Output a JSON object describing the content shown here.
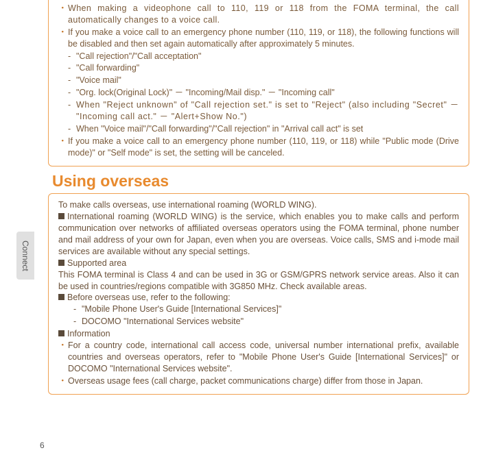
{
  "sidebar": {
    "label": "Connect"
  },
  "box1": {
    "items": [
      {
        "text": "When making a videophone call to 110, 119 or 118 from the FOMA terminal, the call automatically changes to a voice call."
      },
      {
        "text": "If you make a voice call to an emergency phone number (110, 119, or 118), the following functions will be disabled and then set again automatically after approximately 5 minutes.",
        "subs": [
          "\"Call rejection\"/\"Call acceptation\"",
          "\"Call forwarding\"",
          "\"Voice mail\"",
          "\"Org. lock(Original Lock)\" － \"Incoming/Mail disp.\" － \"Incoming call\"",
          "When \"Reject unknown\" of \"Call rejection set.\" is set to \"Reject\" (also including \"Secret\" － \"Incoming call act.\" － \"Alert+Show No.\")",
          "When \"Voice mail\"/\"Call forwarding\"/\"Call rejection\" in \"Arrival call act\" is set"
        ]
      },
      {
        "text": "If you make a voice call to an emergency phone number (110, 119, or 118) while \"Public mode (Drive mode)\" or \"Self mode\" is set, the setting will be canceled."
      }
    ]
  },
  "heading": "Using overseas",
  "box2": {
    "intro": "To make calls overseas, use international roaming (WORLD WING).",
    "worldwing_label": "International roaming (WORLD WING) is the service, which enables you to make calls and perform communication over networks of affiliated overseas operators using the FOMA terminal, phone number and mail address of your own for Japan, even when you are overseas. Voice calls, SMS and i-mode mail services are available without any special settings.",
    "supported_label": "Supported area",
    "supported_text": "This FOMA terminal is Class 4 and can be used in 3G or GSM/GPRS network service areas. Also it can be used in countries/regions compatible with 3G850 MHz. Check available areas.",
    "before_label": "Before overseas use, refer to the following:",
    "before_subs": [
      "\"Mobile Phone User's Guide [International Services]\"",
      "DOCOMO \"International Services website\""
    ],
    "info_label": "Information",
    "info_items": [
      "For a country code, international call access code, universal number international prefix, available countries and overseas operators, refer to \"Mobile Phone User's Guide [International Services]\" or DOCOMO \"International Services website\".",
      "Overseas usage fees (call charge, packet communications charge) differ from those in Japan."
    ]
  },
  "page_number": "6"
}
